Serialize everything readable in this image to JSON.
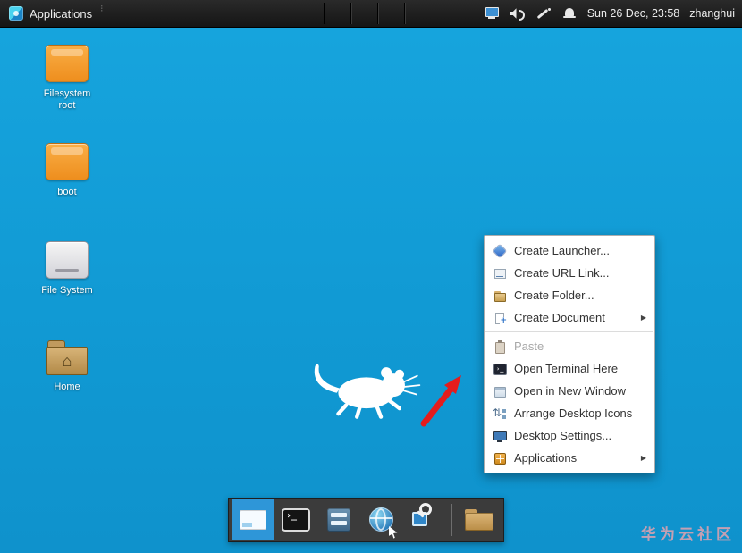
{
  "colors": {
    "desktop_bg": "#119ad4",
    "dock_active": "#2e96d8",
    "arrow_red": "#e51c1c",
    "panel_bg": "#1c1c1c"
  },
  "panel": {
    "applications_label": "Applications",
    "clock": "Sun 26 Dec, 23:58",
    "username": "zhanghui",
    "tray_icons": [
      "display-icon",
      "volume-icon",
      "pen-icon",
      "notifications-bell-icon"
    ]
  },
  "desktop": {
    "icons": [
      {
        "label": "Filesystem root",
        "kind": "drive-orange"
      },
      {
        "label": "boot",
        "kind": "drive-orange"
      },
      {
        "label": "File System",
        "kind": "drive-light"
      },
      {
        "label": "Home",
        "kind": "folder-home"
      }
    ],
    "watermark": "华为云社区"
  },
  "context_menu": {
    "items": [
      {
        "type": "item",
        "label": "Create Launcher...",
        "icon": "create-launcher-icon",
        "enabled": true,
        "has_submenu": false
      },
      {
        "type": "item",
        "label": "Create URL Link...",
        "icon": "create-url-link-icon",
        "enabled": true,
        "has_submenu": false
      },
      {
        "type": "item",
        "label": "Create Folder...",
        "icon": "create-folder-icon",
        "enabled": true,
        "has_submenu": false
      },
      {
        "type": "item",
        "label": "Create Document",
        "icon": "create-document-icon",
        "enabled": true,
        "has_submenu": true
      },
      {
        "type": "separator"
      },
      {
        "type": "item",
        "label": "Paste",
        "icon": "paste-icon",
        "enabled": false,
        "has_submenu": false
      },
      {
        "type": "item",
        "label": "Open Terminal Here",
        "icon": "terminal-icon",
        "enabled": true,
        "has_submenu": false
      },
      {
        "type": "item",
        "label": "Open in New Window",
        "icon": "open-window-icon",
        "enabled": true,
        "has_submenu": false
      },
      {
        "type": "item",
        "label": "Arrange Desktop Icons",
        "icon": "arrange-icons-icon",
        "enabled": true,
        "has_submenu": false
      },
      {
        "type": "item",
        "label": "Desktop Settings...",
        "icon": "desktop-settings-icon",
        "enabled": true,
        "has_submenu": false
      },
      {
        "type": "item",
        "label": "Applications",
        "icon": "applications-icon",
        "enabled": true,
        "has_submenu": true
      }
    ]
  },
  "dock": {
    "items": [
      {
        "name": "desktop-switcher",
        "active": true
      },
      {
        "name": "terminal",
        "active": false
      },
      {
        "name": "file-manager",
        "active": false
      },
      {
        "name": "web-browser",
        "active": false
      },
      {
        "name": "app-finder",
        "active": false
      },
      {
        "name": "separator"
      },
      {
        "name": "folder",
        "active": false
      }
    ]
  }
}
